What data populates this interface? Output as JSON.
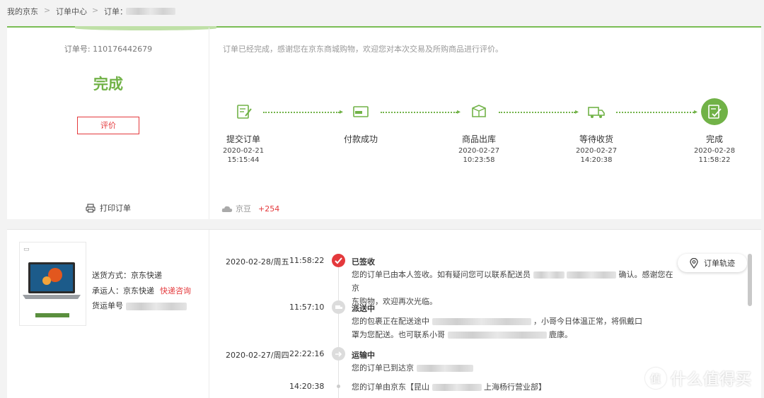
{
  "breadcrumb": {
    "items": [
      "我的京东",
      "订单中心",
      "订单："
    ],
    "separator": ">"
  },
  "order": {
    "number_label": "订单号: 110176442679",
    "status": "完成",
    "review_button": "评价",
    "print_label": "打印订单",
    "notice": "订单已经完成，感谢您在京东商城购物，欢迎您对本次交易及所购商品进行评价。"
  },
  "progress": {
    "steps": [
      {
        "label": "提交订单",
        "date": "2020-02-21",
        "time": "15:15:44",
        "icon": "submit-order-icon"
      },
      {
        "label": "付款成功",
        "date": "",
        "time": "",
        "icon": "payment-icon"
      },
      {
        "label": "商品出库",
        "date": "2020-02-27",
        "time": "10:23:58",
        "icon": "warehouse-box-icon"
      },
      {
        "label": "等待收货",
        "date": "2020-02-27",
        "time": "14:20:38",
        "icon": "delivery-truck-icon"
      },
      {
        "label": "完成",
        "date": "2020-02-28",
        "time": "11:58:22",
        "icon": "complete-check-icon"
      }
    ]
  },
  "beans": {
    "label": "京豆",
    "value": "+254"
  },
  "shipping": {
    "method": "送货方式：京东快递",
    "carrier_label": "承运人：京东快递",
    "consult_link": "快递咨询",
    "tracking_label": "货运单号"
  },
  "tracking": {
    "button_label": "订单轨迹",
    "events": [
      {
        "date": "2020-02-28/周五",
        "time": "11:58:22",
        "title": "已签收",
        "text": "您的订单已由本人签收。如有疑问您可以联系配送员",
        "text_b": "确认。感谢您在京",
        "text_c": "东购物，欢迎再次光临。"
      },
      {
        "date": "",
        "time": "11:57:10",
        "title": "派送中",
        "text": "您的包裹正在配送途中",
        "text_b": "，小哥今日体温正常，将佩戴口",
        "text_c": "罩为您配送。也可联系小哥",
        "text_d": "鹿康。"
      },
      {
        "date": "2020-02-27/周四",
        "time": "22:22:16",
        "title": "运输中",
        "text": "您的订单已到达京"
      },
      {
        "date": "",
        "time": "14:20:38",
        "title": "",
        "text": "您的订单由京东【昆山",
        "text_b": "上海杨行营业部】"
      }
    ]
  },
  "watermark": {
    "text": "什么值得买",
    "glyph": "值"
  },
  "colors": {
    "accent_green": "#71b247",
    "red": "#e4393c"
  }
}
